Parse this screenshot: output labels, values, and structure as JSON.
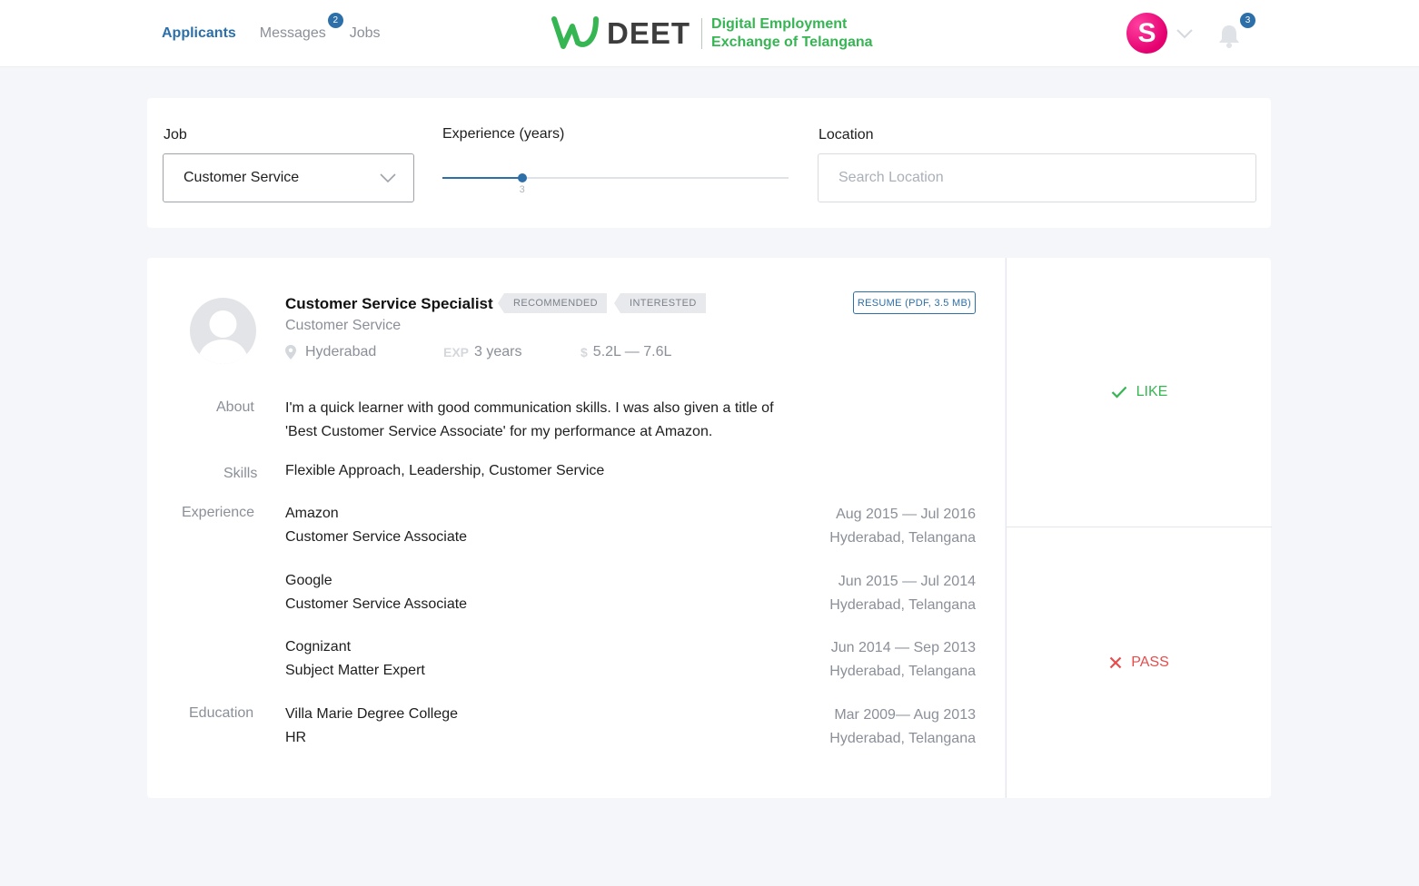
{
  "nav": {
    "items": [
      {
        "label": "Applicants",
        "active": true
      },
      {
        "label": "Messages",
        "badge": "2"
      },
      {
        "label": "Jobs"
      }
    ]
  },
  "brand": {
    "wordmark": "DEET",
    "line1": "Digital Employment",
    "line2": "Exchange of Telangana",
    "green": "#36b553"
  },
  "user": {
    "avatar_letter": "S",
    "notifications": "3"
  },
  "filters": {
    "job_label": "Job",
    "job_value": "Customer Service",
    "experience_label": "Experience (years)",
    "experience_value": "3",
    "experience_fraction": 0.23,
    "location_label": "Location",
    "location_placeholder": "Search Location",
    "location_value": ""
  },
  "applicant": {
    "title": "Customer Service Specialist",
    "tags": [
      "RECOMMENDED",
      "INTERESTED"
    ],
    "resume_label": "RESUME (PDF, 3.5 MB)",
    "category": "Customer Service",
    "location": "Hyderabad",
    "exp_label": "EXP",
    "exp_value": "3 years",
    "salary_symbol": "$",
    "salary": "5.2L — 7.6L",
    "about_label": "About",
    "about_line1": "I'm a quick learner with good communication skills. I was also given a title of",
    "about_line2": "'Best Customer Service Associate' for my performance at Amazon.",
    "skills_label": "Skills",
    "skills": "Flexible Approach, Leadership, Customer Service",
    "experience_label": "Experience",
    "experience": [
      {
        "company": "Amazon",
        "role": "Customer Service Associate",
        "dates": "Aug 2015 — Jul 2016",
        "place": "Hyderabad, Telangana"
      },
      {
        "company": "Google",
        "role": "Customer Service Associate",
        "dates": "Jun 2015 — Jul 2014",
        "place": "Hyderabad, Telangana"
      },
      {
        "company": "Cognizant",
        "role": "Subject Matter Expert",
        "dates": "Jun 2014 — Sep 2013",
        "place": "Hyderabad, Telangana"
      }
    ],
    "education_label": "Education",
    "education": {
      "school": "Villa Marie Degree College",
      "field": "HR",
      "dates": "Mar 2009— Aug 2013",
      "place": "Hyderabad, Telangana"
    }
  },
  "actions": {
    "like": "LIKE",
    "pass": "PASS"
  },
  "colors": {
    "accent": "#2d6fa8",
    "like": "#36b553",
    "pass": "#e84b4b",
    "avatar": "#e4006f"
  }
}
